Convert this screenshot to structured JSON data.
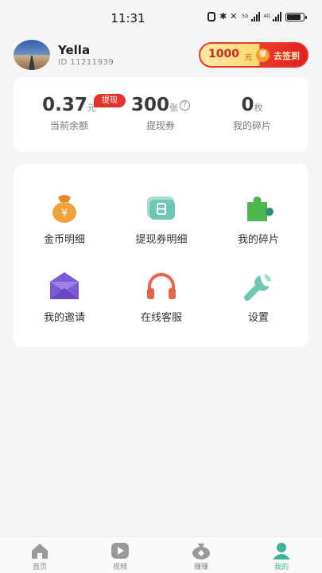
{
  "status_bar": {
    "time": "11:31",
    "net_label": "5G",
    "net_label2": "4G",
    "icons": [
      "nfc-icon",
      "bluetooth-icon",
      "mute-icon",
      "signal-icon",
      "signal-icon",
      "battery-icon"
    ]
  },
  "profile": {
    "name": "Yella",
    "id_text": "ID  11211939",
    "checkin": {
      "amount": "1000",
      "unit": "元",
      "ling": "领",
      "action": "去签到"
    }
  },
  "wallet": {
    "balance": {
      "value": "0.37",
      "unit": "元",
      "label": "当前余额",
      "badge": "提现"
    },
    "vouchers": {
      "value": "300",
      "unit": "张",
      "label": "提现券",
      "help": "?"
    },
    "fragments": {
      "value": "0",
      "unit": "枚",
      "label": "我的碎片"
    }
  },
  "menu": [
    {
      "label": "金币明细",
      "icon": "money-bag-icon"
    },
    {
      "label": "提现券明细",
      "icon": "ticket-icon"
    },
    {
      "label": "我的碎片",
      "icon": "puzzle-icon"
    },
    {
      "label": "我的邀请",
      "icon": "envelope-icon"
    },
    {
      "label": "在线客服",
      "icon": "headphones-icon"
    },
    {
      "label": "设置",
      "icon": "wrench-icon"
    }
  ],
  "nav": [
    {
      "label": "首页",
      "icon": "home-icon"
    },
    {
      "label": "视频",
      "icon": "play-icon"
    },
    {
      "label": "赚赚",
      "icon": "coin-bag-icon"
    },
    {
      "label": "我的",
      "icon": "profile-icon",
      "active": true
    }
  ],
  "colors": {
    "accent": "#3db19a",
    "badge": "#e3332a",
    "checkin_red": "#e21f1f"
  }
}
